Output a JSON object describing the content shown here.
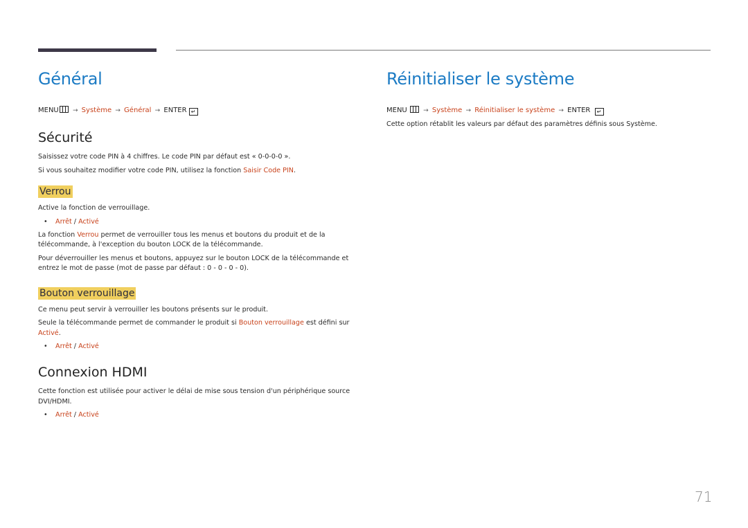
{
  "decor": {
    "accent_bar_color": "#3d3848",
    "rule_color": "#7a7a7a",
    "title_color": "#1c7bc4",
    "highlight_color": "#c8421b",
    "subtitle_bg": "#f0cf5e"
  },
  "left": {
    "title": "Général",
    "menu_path": {
      "menu": "MENU",
      "menu_icon": "menu-grid-icon",
      "arrow": "→",
      "step1": "Système",
      "step2": "Général",
      "enter": "ENTER",
      "enter_icon": "enter-icon"
    },
    "securite": {
      "title": "Sécurité",
      "p1": "Saisissez votre code PIN à 4 chiffres. Le code PIN par défaut est « 0-0-0-0 ».",
      "p2_before": "Si vous souhaitez modifier votre code PIN, utilisez la fonction ",
      "p2_link": "Saisir Code PIN",
      "p2_after": "."
    },
    "verrou": {
      "title": "Verrou",
      "p1": "Active la fonction de verrouillage.",
      "option_off": "Arrêt",
      "option_sep": " / ",
      "option_on": "Activé",
      "p2_before": "La fonction ",
      "p2_link": "Verrou",
      "p2_mid": " permet de verrouiller tous les menus et boutons du produit et de la télécommande, à l'exception du bouton ",
      "p2_lock": "LOCK",
      "p2_after": " de la télécommande.",
      "p3_before": "Pour déverrouiller les menus et boutons, appuyez sur le bouton ",
      "p3_lock": "LOCK",
      "p3_after": " de la télécommande et entrez le mot de passe (mot de passe par défaut : 0 - 0 - 0 - 0)."
    },
    "bouton_verrouillage": {
      "title": "Bouton verrouillage",
      "p1": "Ce menu peut servir à verrouiller les boutons présents sur le produit.",
      "p2_before": "Seule la télécommande permet de commander le produit si ",
      "p2_link": "Bouton verrouillage",
      "p2_mid": " est défini sur ",
      "p2_link2": "Activé",
      "p2_after": ".",
      "option_off": "Arrêt",
      "option_sep": " / ",
      "option_on": "Activé"
    },
    "connexion_hdmi": {
      "title": "Connexion HDMI",
      "p1": "Cette fonction est utilisée pour activer le délai de mise sous tension d'un périphérique source DVI/HDMI.",
      "option_off": "Arrêt",
      "option_sep": " / ",
      "option_on": "Activé"
    }
  },
  "right": {
    "title": "Réinitialiser le système",
    "menu_path": {
      "menu": "MENU",
      "arrow": "→",
      "step1": "Système",
      "step2": "Réinitialiser le système",
      "enter": "ENTER"
    },
    "p1": "Cette option rétablit les valeurs par défaut des paramètres définis sous Système."
  },
  "bullet_glyph": "•",
  "enter_glyph": "↵",
  "page_number": "71"
}
